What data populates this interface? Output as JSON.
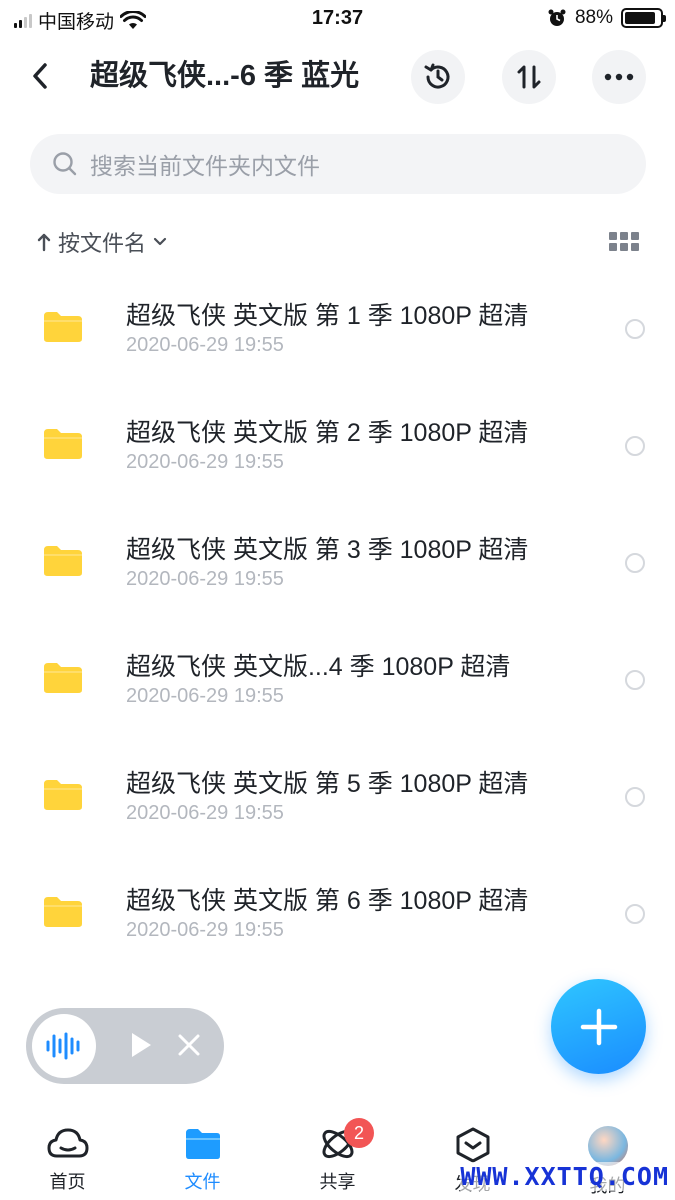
{
  "status_bar": {
    "carrier": "中国移动",
    "time": "17:37",
    "battery_percent": "88%",
    "battery_level": 0.88
  },
  "header": {
    "title": "超级飞侠...-6 季 蓝光",
    "icons": [
      "back-icon",
      "history-icon",
      "sort-icon",
      "more-icon"
    ]
  },
  "search": {
    "placeholder": "搜索当前文件夹内文件"
  },
  "sort": {
    "label": "按文件名"
  },
  "files": [
    {
      "name": "超级飞侠 英文版 第 1 季 1080P 超清",
      "date": "2020-06-29 19:55"
    },
    {
      "name": "超级飞侠 英文版 第 2 季 1080P 超清",
      "date": "2020-06-29 19:55"
    },
    {
      "name": "超级飞侠 英文版 第 3 季 1080P 超清",
      "date": "2020-06-29 19:55"
    },
    {
      "name": "超级飞侠 英文版...4 季 1080P 超清",
      "date": "2020-06-29 19:55"
    },
    {
      "name": "超级飞侠 英文版 第 5 季 1080P 超清",
      "date": "2020-06-29 19:55"
    },
    {
      "name": "超级飞侠 英文版 第 6 季 1080P 超清",
      "date": "2020-06-29 19:55"
    }
  ],
  "nav": {
    "items": [
      {
        "label": "首页",
        "icon": "cloud-home-icon"
      },
      {
        "label": "文件",
        "icon": "folder-icon"
      },
      {
        "label": "共享",
        "icon": "share-orbit-icon",
        "badge": "2"
      },
      {
        "label": "发现",
        "icon": "discover-icon"
      },
      {
        "label": "我的",
        "icon": "avatar"
      }
    ],
    "active_index": 1
  },
  "watermark": "WWW.XXTTQ.COM",
  "colors": {
    "accent": "#1e8cff",
    "folder": "#ffd43b",
    "badge": "#f25555"
  }
}
